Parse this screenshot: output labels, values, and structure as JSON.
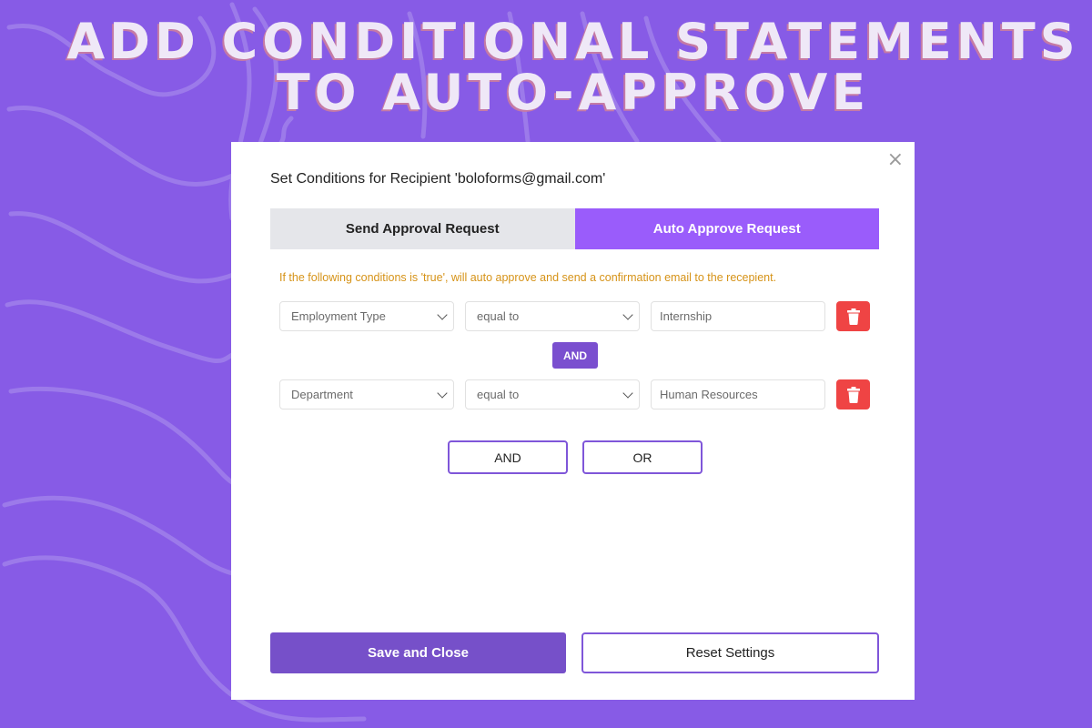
{
  "headline": {
    "line1": "ADD CONDITIONAL STATEMENTS",
    "line2": "TO AUTO-APPROVE"
  },
  "modal": {
    "close_icon": "×",
    "title": "Set Conditions for Recipient 'boloforms@gmail.com'",
    "tabs": [
      {
        "label": "Send Approval Request",
        "active": false
      },
      {
        "label": "Auto Approve Request",
        "active": true
      }
    ],
    "info_text": "If the following conditions is 'true', will auto approve and send a confirmation email to the recepient.",
    "conditions": [
      {
        "field": "Employment Type",
        "operator": "equal to",
        "value": "Internship",
        "delete_icon": "trash-icon"
      },
      {
        "field": "Department",
        "operator": "equal to",
        "value": "Human Resources",
        "delete_icon": "trash-icon"
      }
    ],
    "connector_label": "AND",
    "add_logic_buttons": {
      "and_label": "AND",
      "or_label": "OR"
    },
    "footer": {
      "save_label": "Save and Close",
      "reset_label": "Reset Settings"
    }
  },
  "colors": {
    "background": "#875be6",
    "accent": "#9a5cfb",
    "primary_button": "#7650c9",
    "warning_text": "#d69318",
    "delete": "#ef4444"
  }
}
